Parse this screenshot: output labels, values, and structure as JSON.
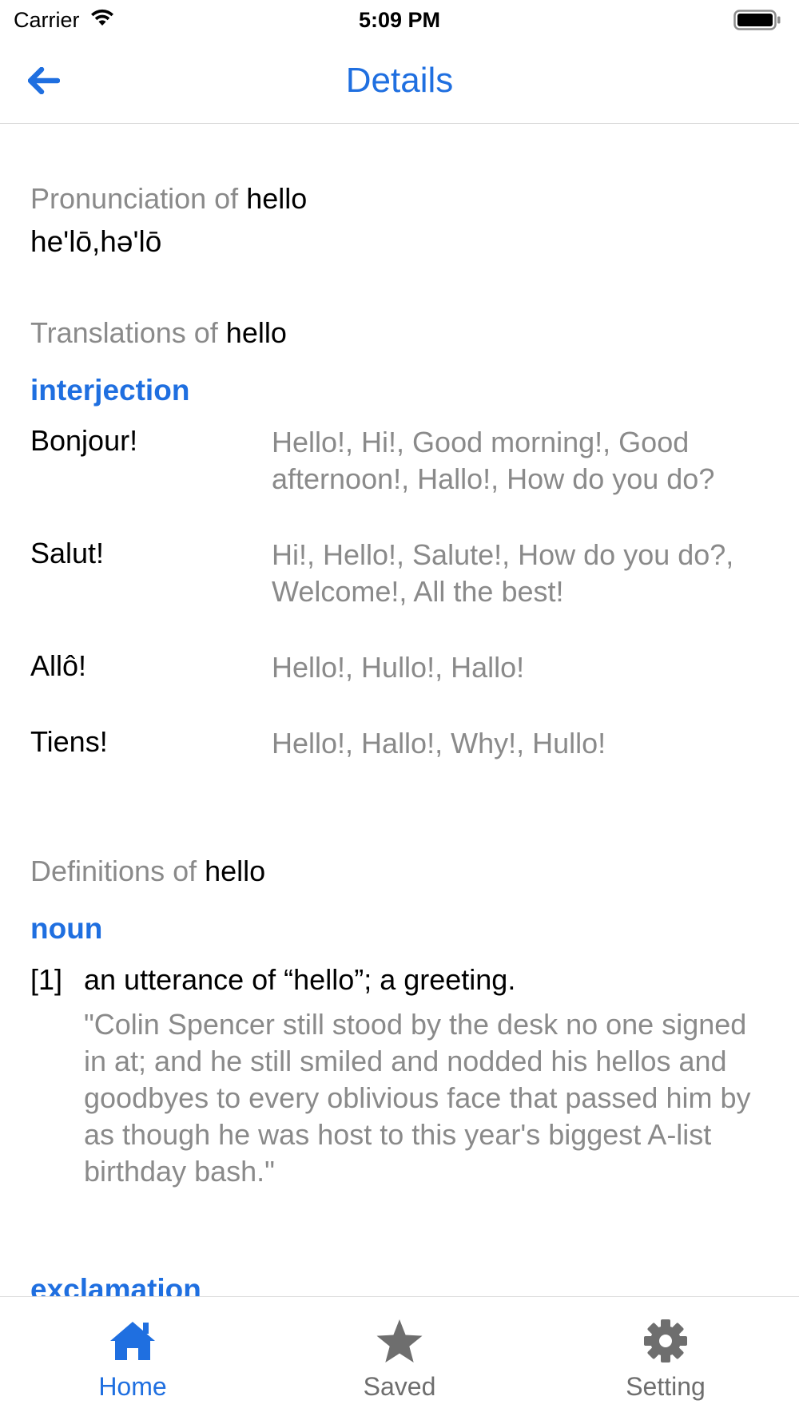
{
  "status_bar": {
    "carrier": "Carrier",
    "time": "5:09 PM"
  },
  "nav": {
    "title": "Details",
    "back_icon": "arrow-left-icon",
    "accent_color": "#1f6fe0"
  },
  "pronunciation": {
    "heading_prefix": "Pronunciation of",
    "word": "hello",
    "text": "he'lō,hə'lō"
  },
  "translations": {
    "heading_prefix": "Translations of",
    "word": "hello",
    "part_of_speech": "interjection",
    "rows": [
      {
        "word": "Bonjour!",
        "meanings": "Hello!, Hi!, Good morning!, Good afternoon!, Hallo!, How do you do?"
      },
      {
        "word": "Salut!",
        "meanings": "Hi!, Hello!, Salute!, How do you do?, Welcome!, All the best!"
      },
      {
        "word": "Allô!",
        "meanings": "Hello!, Hullo!, Hallo!"
      },
      {
        "word": "Tiens!",
        "meanings": "Hello!, Hallo!, Why!, Hullo!"
      }
    ]
  },
  "definitions": {
    "heading_prefix": "Definitions of",
    "word": "hello",
    "part_of_speech": "noun",
    "items": [
      {
        "number": "[1]",
        "text": "an utterance of “hello”; a greeting.",
        "example": "\"Colin Spencer still stood by the desk no one signed in at; and he still smiled and nodded his hellos and goodbyes to every oblivious face that passed him by as though he was host to this year's biggest A-list birthday bash.\""
      }
    ],
    "next_part_of_speech": "exclamation"
  },
  "tab_bar": {
    "tabs": [
      {
        "label": "Home",
        "icon": "home-icon",
        "active": true
      },
      {
        "label": "Saved",
        "icon": "star-icon",
        "active": false
      },
      {
        "label": "Setting",
        "icon": "gear-icon",
        "active": false
      }
    ]
  }
}
